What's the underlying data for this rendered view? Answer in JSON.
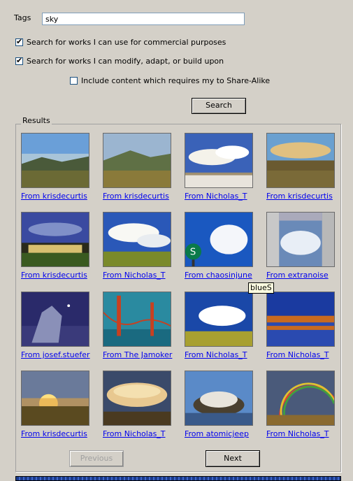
{
  "form": {
    "tags_label": "Tags",
    "tags_value": "sky",
    "commercial_label": "Search for works I can use for commercial purposes",
    "commercial_checked": true,
    "modify_label": "Search for works I can modify, adapt, or build upon",
    "modify_checked": true,
    "sharealike_label": "Include content which requires my to Share-Alike",
    "sharealike_checked": false,
    "search_button": "Search"
  },
  "results": {
    "title": "Results",
    "items": [
      {
        "caption": "From krisdecurtis",
        "theme": "valley"
      },
      {
        "caption": "From krisdecurtis",
        "theme": "valley2"
      },
      {
        "caption": "From Nicholas_T",
        "theme": "cloudsky"
      },
      {
        "caption": "From krisdecurtis",
        "theme": "sunsetvalley"
      },
      {
        "caption": "From krisdecurtis",
        "theme": "town"
      },
      {
        "caption": "From Nicholas_T",
        "theme": "field"
      },
      {
        "caption": "From chaosinjune",
        "theme": "sign"
      },
      {
        "caption": "From extranoise",
        "theme": "buildings"
      },
      {
        "caption": "From josef.stuefer",
        "theme": "statue"
      },
      {
        "caption": "From The Jamoker",
        "theme": "bridge"
      },
      {
        "caption": "From Nicholas_T",
        "theme": "field2"
      },
      {
        "caption": "From Nicholas_T",
        "theme": "lake"
      },
      {
        "caption": "From krisdecurtis",
        "theme": "sunset"
      },
      {
        "caption": "From Nicholas_T",
        "theme": "storm"
      },
      {
        "caption": "From atomicjeep",
        "theme": "island"
      },
      {
        "caption": "From Nicholas_T",
        "theme": "rainbow"
      }
    ],
    "tooltip": "blueS"
  },
  "pager": {
    "previous_label": "Previous",
    "previous_enabled": false,
    "next_label": "Next"
  }
}
